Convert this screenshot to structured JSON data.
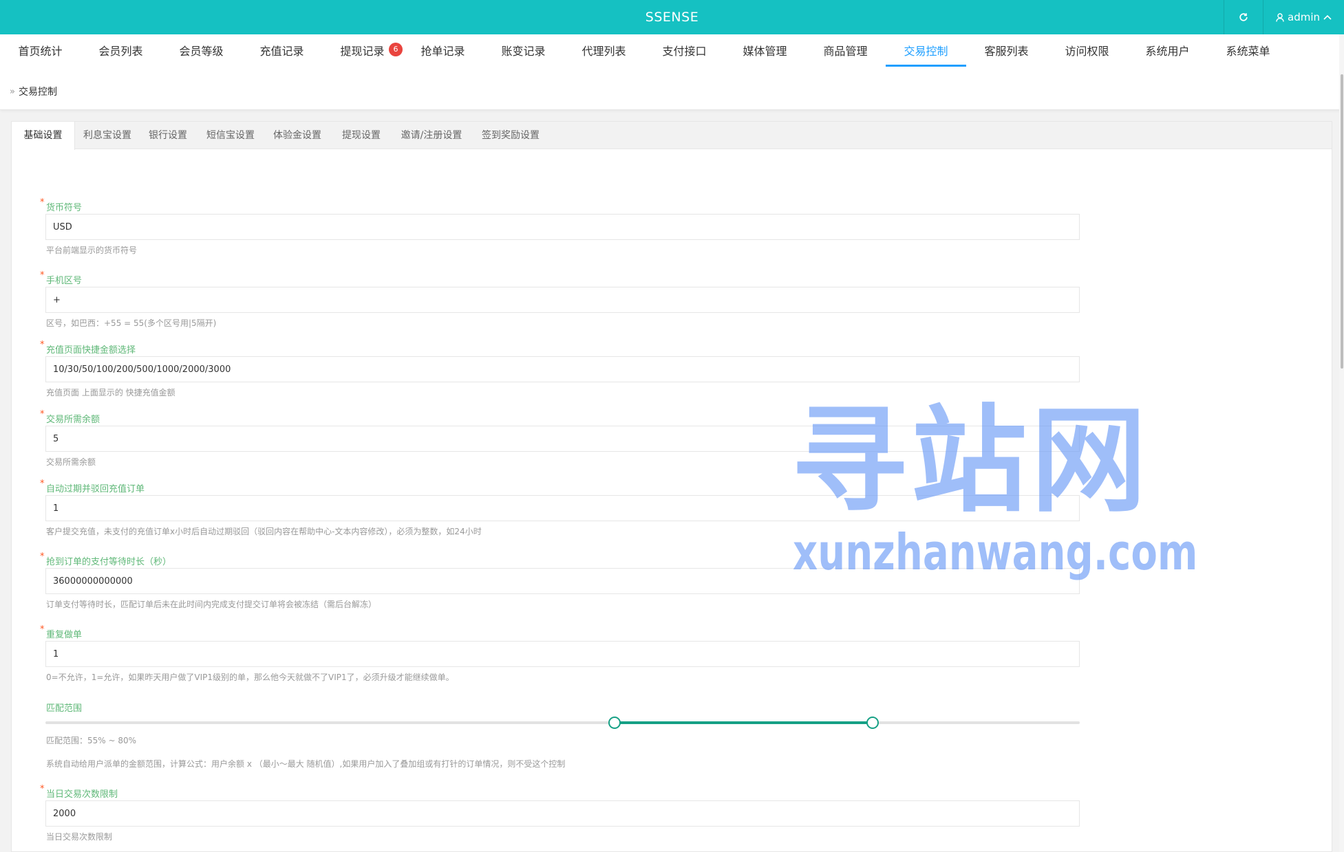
{
  "app": {
    "title": "SSENSE"
  },
  "header": {
    "refresh_icon": "refresh-icon",
    "user_icon": "user-icon",
    "user_name": "admin",
    "user_caret_icon": "chevron-up-icon"
  },
  "nav": {
    "items": [
      {
        "label": "首页统计"
      },
      {
        "label": "会员列表"
      },
      {
        "label": "会员等级"
      },
      {
        "label": "充值记录"
      },
      {
        "label": "提现记录",
        "badge": "6"
      },
      {
        "label": "抢单记录"
      },
      {
        "label": "账变记录"
      },
      {
        "label": "代理列表"
      },
      {
        "label": "支付接口"
      },
      {
        "label": "媒体管理"
      },
      {
        "label": "商品管理"
      },
      {
        "label": "交易控制",
        "active": true
      },
      {
        "label": "客服列表"
      },
      {
        "label": "访问权限"
      },
      {
        "label": "系统用户"
      },
      {
        "label": "系统菜单"
      }
    ]
  },
  "breadcrumb": {
    "current": "交易控制"
  },
  "tabs": [
    {
      "label": "基础设置",
      "active": true
    },
    {
      "label": "利息宝设置"
    },
    {
      "label": "银行设置"
    },
    {
      "label": "短信宝设置"
    },
    {
      "label": "体验金设置"
    },
    {
      "label": "提现设置"
    },
    {
      "label": "邀请/注册设置"
    },
    {
      "label": "签到奖励设置"
    }
  ],
  "form": {
    "fields": [
      {
        "label": "货币符号",
        "required": true,
        "value": "USD",
        "help": "平台前端显示的货币符号"
      },
      {
        "label": "手机区号",
        "required": true,
        "value": "+",
        "help": "区号，如巴西：+55 = 55(多个区号用|5隔开)"
      },
      {
        "label": "充值页面快捷金额选择",
        "required": true,
        "value": "10/30/50/100/200/500/1000/2000/3000",
        "help": "充值页面 上面显示的 快捷充值金额"
      },
      {
        "label": "交易所需余额",
        "required": true,
        "value": "5",
        "help": "交易所需余额"
      },
      {
        "label": "自动过期并驳回充值订单",
        "required": true,
        "value": "1",
        "help": "客户提交充值，未支付的充值订单x小时后自动过期驳回（驳回内容在帮助中心-文本内容修改），必须为整数，如24小时"
      },
      {
        "label": "抢到订单的支付等待时长（秒）",
        "required": true,
        "value": "36000000000000",
        "help": "订单支付等待时长，匹配订单后未在此时间内完成支付提交订单将会被冻结（需后台解冻）"
      },
      {
        "label": "重复做单",
        "required": true,
        "value": "1",
        "help": "0=不允许，1=允许，如果昨天用户做了VIP1级别的单，那么他今天就做不了VIP1了，必须升级才能继续做单。"
      }
    ],
    "match_range": {
      "label": "匹配范围",
      "min": 55,
      "max": 80,
      "range_text": "匹配范围：55% ~ 80%",
      "help": "系统自动给用户派单的金额范围，计算公式：用户余额 x （最小～最大 随机值）,如果用户加入了叠加组或有打针的订单情况，则不受这个控制"
    },
    "daily_limit": {
      "label": "当日交易次数限制",
      "required": true,
      "value": "2000",
      "help": "当日交易次数限制"
    }
  },
  "watermark": {
    "cn": "寻站网",
    "en": "xunzhanwang.com"
  },
  "colors": {
    "topbar": "#15c1c2",
    "nav_active": "#1e9fff",
    "label_green": "#5fb878",
    "slider": "#16a085",
    "badge": "#e9443e"
  }
}
